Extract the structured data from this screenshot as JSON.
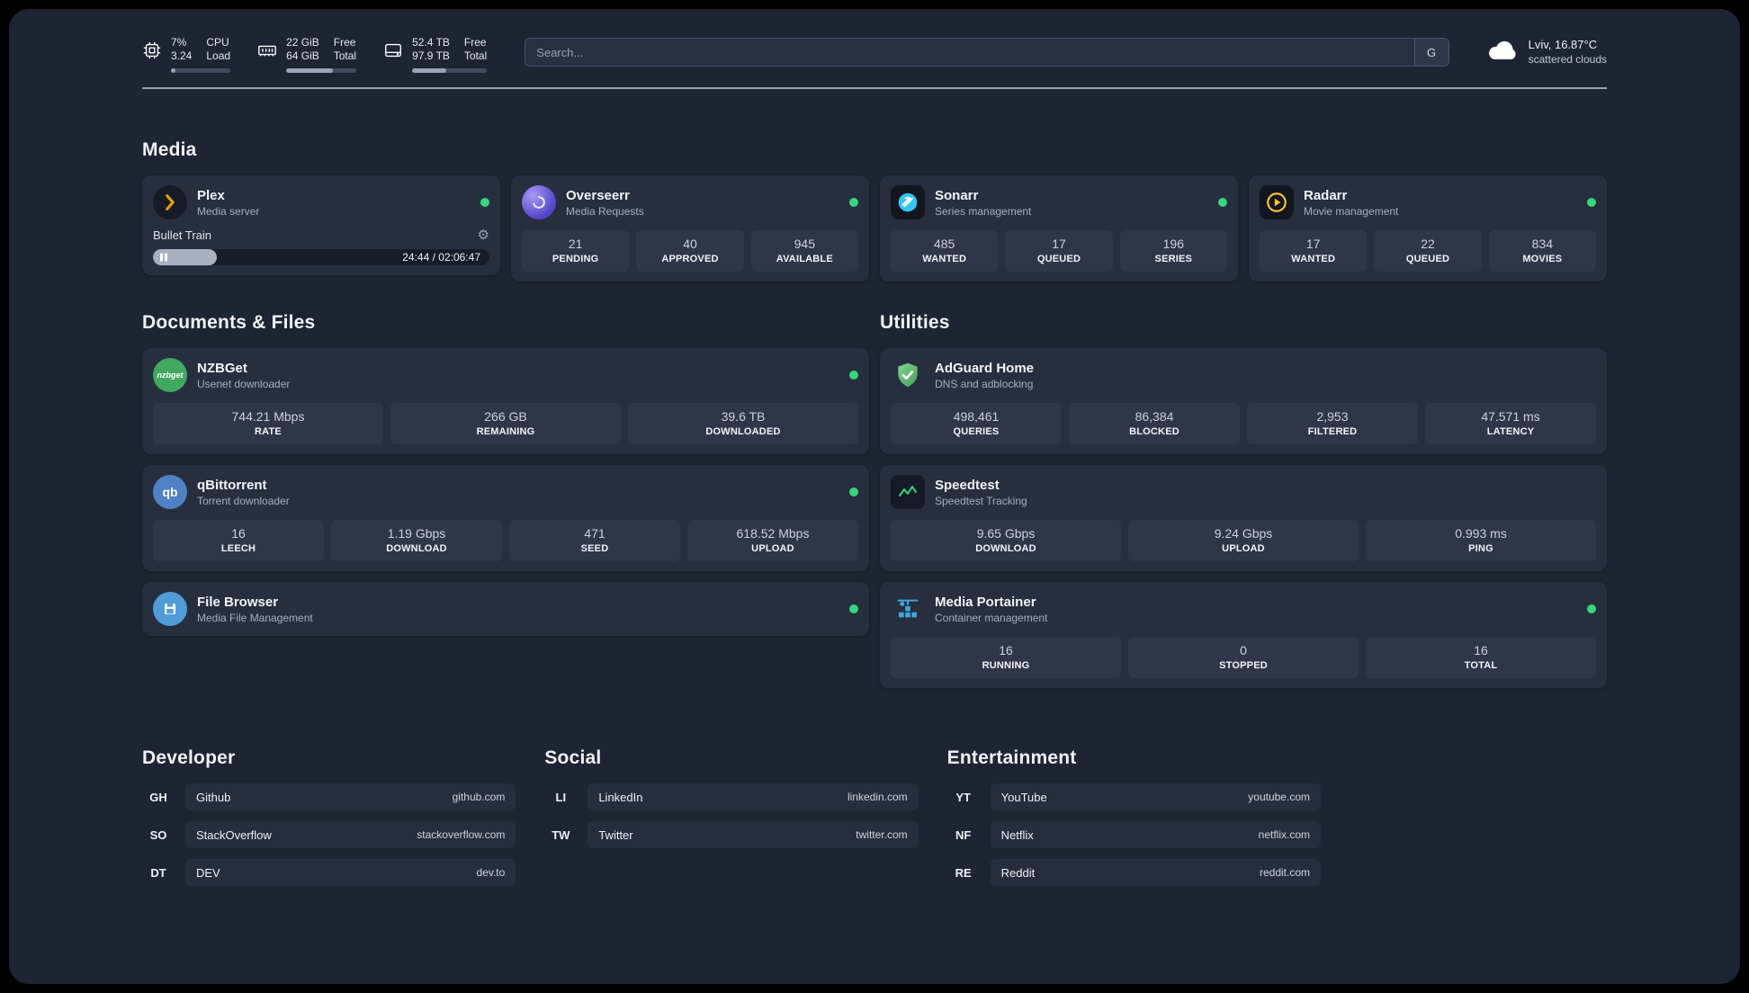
{
  "topbar": {
    "cpu": {
      "value_top": "7%",
      "label_top": "CPU",
      "value_bottom": "3.24",
      "label_bottom": "Load",
      "progress": 7
    },
    "ram": {
      "value_top": "22 GiB",
      "label_top": "Free",
      "value_bottom": "64 GiB",
      "label_bottom": "Total",
      "progress": 66
    },
    "disk": {
      "value_top": "52.4 TB",
      "label_top": "Free",
      "value_bottom": "97.9 TB",
      "label_bottom": "Total",
      "progress": 46
    },
    "search": {
      "placeholder": "Search...",
      "button_label": "G"
    },
    "weather": {
      "location": "Lviv, 16.87°C",
      "condition": "scattered clouds"
    }
  },
  "sections": {
    "media": {
      "title": "Media"
    },
    "documents": {
      "title": "Documents & Files"
    },
    "utilities": {
      "title": "Utilities"
    }
  },
  "media_apps": {
    "plex": {
      "name": "Plex",
      "subtitle": "Media server",
      "status": "online",
      "player": {
        "title": "Bullet Train",
        "time": "24:44 / 02:06:47",
        "progress_percent": 19
      }
    },
    "overseerr": {
      "name": "Overseerr",
      "subtitle": "Media Requests",
      "status": "online",
      "stats": [
        {
          "value": "21",
          "label": "PENDING"
        },
        {
          "value": "40",
          "label": "APPROVED"
        },
        {
          "value": "945",
          "label": "AVAILABLE"
        }
      ]
    },
    "sonarr": {
      "name": "Sonarr",
      "subtitle": "Series management",
      "status": "online",
      "stats": [
        {
          "value": "485",
          "label": "WANTED"
        },
        {
          "value": "17",
          "label": "QUEUED"
        },
        {
          "value": "196",
          "label": "SERIES"
        }
      ]
    },
    "radarr": {
      "name": "Radarr",
      "subtitle": "Movie management",
      "status": "online",
      "stats": [
        {
          "value": "17",
          "label": "WANTED"
        },
        {
          "value": "22",
          "label": "QUEUED"
        },
        {
          "value": "834",
          "label": "MOVIES"
        }
      ]
    }
  },
  "documents_apps": {
    "nzbget": {
      "name": "NZBGet",
      "subtitle": "Usenet downloader",
      "status": "online",
      "icon_text": "nzbget",
      "stats": [
        {
          "value": "744.21 Mbps",
          "label": "RATE"
        },
        {
          "value": "266 GB",
          "label": "REMAINING"
        },
        {
          "value": "39.6 TB",
          "label": "DOWNLOADED"
        }
      ]
    },
    "qbittorrent": {
      "name": "qBittorrent",
      "subtitle": "Torrent downloader",
      "status": "online",
      "icon_text": "qb",
      "stats": [
        {
          "value": "16",
          "label": "LEECH"
        },
        {
          "value": "1.19 Gbps",
          "label": "DOWNLOAD"
        },
        {
          "value": "471",
          "label": "SEED"
        },
        {
          "value": "618.52 Mbps",
          "label": "UPLOAD"
        }
      ]
    },
    "filebrowser": {
      "name": "File Browser",
      "subtitle": "Media File Management",
      "status": "online"
    }
  },
  "utilities_apps": {
    "adguard": {
      "name": "AdGuard Home",
      "subtitle": "DNS and adblocking",
      "stats": [
        {
          "value": "498,461",
          "label": "QUERIES"
        },
        {
          "value": "86,384",
          "label": "BLOCKED"
        },
        {
          "value": "2,953",
          "label": "FILTERED"
        },
        {
          "value": "47.571 ms",
          "label": "LATENCY"
        }
      ]
    },
    "speedtest": {
      "name": "Speedtest",
      "subtitle": "Speedtest Tracking",
      "stats": [
        {
          "value": "9.65 Gbps",
          "label": "DOWNLOAD"
        },
        {
          "value": "9.24 Gbps",
          "label": "UPLOAD"
        },
        {
          "value": "0.993 ms",
          "label": "PING"
        }
      ]
    },
    "portainer": {
      "name": "Media Portainer",
      "subtitle": "Container management",
      "status": "online",
      "stats": [
        {
          "value": "16",
          "label": "RUNNING"
        },
        {
          "value": "0",
          "label": "STOPPED"
        },
        {
          "value": "16",
          "label": "TOTAL"
        }
      ]
    }
  },
  "bookmarks": {
    "developer": {
      "title": "Developer",
      "items": [
        {
          "abbr": "GH",
          "name": "Github",
          "url": "github.com"
        },
        {
          "abbr": "SO",
          "name": "StackOverflow",
          "url": "stackoverflow.com"
        },
        {
          "abbr": "DT",
          "name": "DEV",
          "url": "dev.to"
        }
      ]
    },
    "social": {
      "title": "Social",
      "items": [
        {
          "abbr": "LI",
          "name": "LinkedIn",
          "url": "linkedin.com"
        },
        {
          "abbr": "TW",
          "name": "Twitter",
          "url": "twitter.com"
        }
      ]
    },
    "entertainment": {
      "title": "Entertainment",
      "items": [
        {
          "abbr": "YT",
          "name": "YouTube",
          "url": "youtube.com"
        },
        {
          "abbr": "NF",
          "name": "Netflix",
          "url": "netflix.com"
        },
        {
          "abbr": "RE",
          "name": "Reddit",
          "url": "reddit.com"
        }
      ]
    }
  }
}
